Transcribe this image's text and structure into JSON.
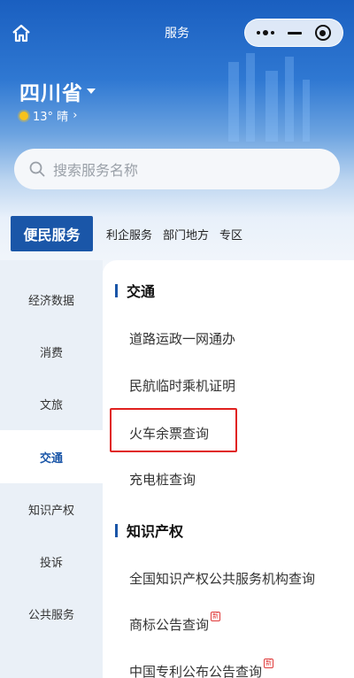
{
  "nav": {
    "title": "服务"
  },
  "location": {
    "province": "四川省",
    "weather": "13°  晴",
    "weather_arrow": "›"
  },
  "search": {
    "placeholder": "搜索服务名称"
  },
  "tabs": [
    "便民服务",
    "利企服务",
    "部门地方",
    "专区"
  ],
  "sidebar": [
    "经济数据",
    "消费",
    "文旅",
    "交通",
    "知识产权",
    "投诉",
    "公共服务"
  ],
  "sections": [
    {
      "title": "交通",
      "items": [
        "道路运政一网通办",
        "民航临时乘机证明",
        "火车余票查询",
        "充电桩查询"
      ]
    },
    {
      "title": "知识产权",
      "items": [
        "全国知识产权公共服务机构查询",
        "商标公告查询",
        "中国专利公布公告查询"
      ]
    }
  ],
  "badge_text": "新",
  "colors": {
    "primary": "#1a56a8",
    "highlight": "#e0201e",
    "new_badge": "#e03a3a"
  }
}
